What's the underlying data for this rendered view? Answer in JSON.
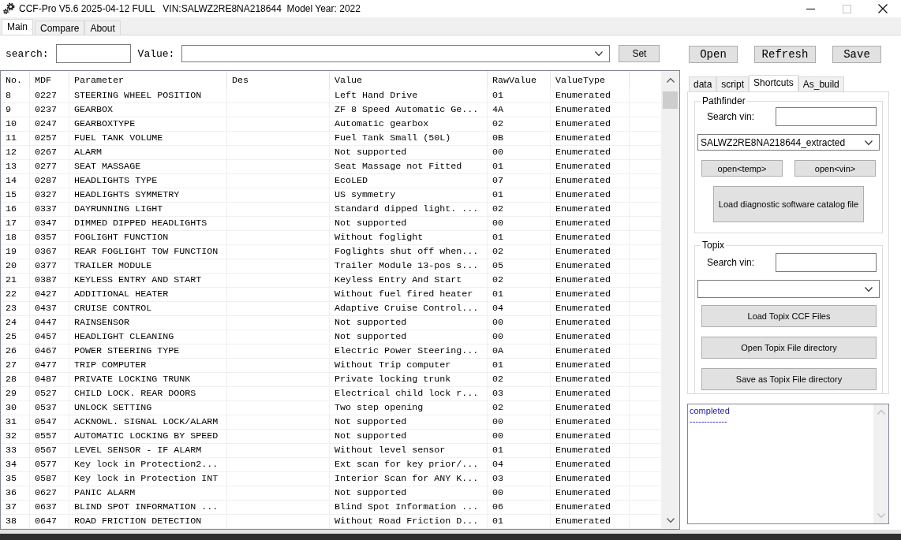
{
  "window": {
    "title": "CCF-Pro V5.6 2025-04-12 FULL   VIN:SALWZ2RE8NA218644  Model Year: 2022"
  },
  "tabs": [
    {
      "label": "Main",
      "selected": true
    },
    {
      "label": "Compare",
      "selected": false
    },
    {
      "label": "About",
      "selected": false
    }
  ],
  "search_bar": {
    "search_label": "search:",
    "value_label": "Value:",
    "set_button": "Set"
  },
  "file_buttons": [
    "Open",
    "Refresh",
    "Save"
  ],
  "table": {
    "columns": [
      "No.",
      "MDF",
      "Parameter",
      "Des",
      "Value",
      "RawValue",
      "ValueType"
    ],
    "rows": [
      {
        "no": "8",
        "mdf": "0227",
        "parameter": "STEERING WHEEL POSITION",
        "value": "Left Hand Drive",
        "raw_value": "01",
        "value_type": "Enumerated"
      },
      {
        "no": "9",
        "mdf": "0237",
        "parameter": "GEARBOX",
        "value": "ZF 8 Speed Automatic Ge...",
        "raw_value": "4A",
        "value_type": "Enumerated"
      },
      {
        "no": "10",
        "mdf": "0247",
        "parameter": "GEARBOXTYPE",
        "value": "Automatic gearbox",
        "raw_value": "02",
        "value_type": "Enumerated"
      },
      {
        "no": "11",
        "mdf": "0257",
        "parameter": "FUEL TANK VOLUME",
        "value": "Fuel Tank Small (50L)",
        "raw_value": "0B",
        "value_type": "Enumerated"
      },
      {
        "no": "12",
        "mdf": "0267",
        "parameter": "ALARM",
        "value": "Not supported",
        "raw_value": "00",
        "value_type": "Enumerated"
      },
      {
        "no": "13",
        "mdf": "0277",
        "parameter": "SEAT MASSAGE",
        "value": "Seat Massage not Fitted",
        "raw_value": "01",
        "value_type": "Enumerated"
      },
      {
        "no": "14",
        "mdf": "0287",
        "parameter": "HEADLIGHTS TYPE",
        "value": "EcoLED",
        "raw_value": "07",
        "value_type": "Enumerated"
      },
      {
        "no": "15",
        "mdf": "0327",
        "parameter": "HEADLIGHTS SYMMETRY",
        "value": "US symmetry",
        "raw_value": "01",
        "value_type": "Enumerated"
      },
      {
        "no": "16",
        "mdf": "0337",
        "parameter": "DAYRUNNING LIGHT",
        "value": "Standard dipped light. ...",
        "raw_value": "02",
        "value_type": "Enumerated"
      },
      {
        "no": "17",
        "mdf": "0347",
        "parameter": "DIMMED DIPPED HEADLIGHTS",
        "value": "Not supported",
        "raw_value": "00",
        "value_type": "Enumerated"
      },
      {
        "no": "18",
        "mdf": "0357",
        "parameter": "FOGLIGHT FUNCTION",
        "value": "Without foglight",
        "raw_value": "01",
        "value_type": "Enumerated"
      },
      {
        "no": "19",
        "mdf": "0367",
        "parameter": "REAR FOGLIGHT TOW FUNCTION",
        "value": "Foglights shut off when...",
        "raw_value": "02",
        "value_type": "Enumerated"
      },
      {
        "no": "20",
        "mdf": "0377",
        "parameter": "TRAILER MODULE",
        "value": "Trailer Module 13-pos s...",
        "raw_value": "05",
        "value_type": "Enumerated"
      },
      {
        "no": "21",
        "mdf": "0387",
        "parameter": "KEYLESS ENTRY AND START",
        "value": "Keyless Entry And Start",
        "raw_value": "02",
        "value_type": "Enumerated"
      },
      {
        "no": "22",
        "mdf": "0427",
        "parameter": "ADDITIONAL HEATER",
        "value": "Without fuel fired heater",
        "raw_value": "01",
        "value_type": "Enumerated"
      },
      {
        "no": "23",
        "mdf": "0437",
        "parameter": "CRUISE CONTROL",
        "value": "Adaptive Cruise Control...",
        "raw_value": "04",
        "value_type": "Enumerated"
      },
      {
        "no": "24",
        "mdf": "0447",
        "parameter": "RAINSENSOR",
        "value": "Not supported",
        "raw_value": "00",
        "value_type": "Enumerated"
      },
      {
        "no": "25",
        "mdf": "0457",
        "parameter": "HEADLIGHT CLEANING",
        "value": "Not supported",
        "raw_value": "00",
        "value_type": "Enumerated"
      },
      {
        "no": "26",
        "mdf": "0467",
        "parameter": "POWER STEERING TYPE",
        "value": "Electric Power Steering...",
        "raw_value": "0A",
        "value_type": "Enumerated"
      },
      {
        "no": "27",
        "mdf": "0477",
        "parameter": "TRIP COMPUTER",
        "value": "Without Trip computer",
        "raw_value": "01",
        "value_type": "Enumerated"
      },
      {
        "no": "28",
        "mdf": "0487",
        "parameter": "PRIVATE LOCKING TRUNK",
        "value": "Private locking trunk",
        "raw_value": "02",
        "value_type": "Enumerated"
      },
      {
        "no": "29",
        "mdf": "0527",
        "parameter": "CHILD LOCK. REAR DOORS",
        "value": "Electrical child lock r...",
        "raw_value": "03",
        "value_type": "Enumerated"
      },
      {
        "no": "30",
        "mdf": "0537",
        "parameter": "UNLOCK SETTING",
        "value": "Two step opening",
        "raw_value": "02",
        "value_type": "Enumerated"
      },
      {
        "no": "31",
        "mdf": "0547",
        "parameter": "ACKNOWL. SIGNAL LOCK/ALARM",
        "value": "Not supported",
        "raw_value": "00",
        "value_type": "Enumerated"
      },
      {
        "no": "32",
        "mdf": "0557",
        "parameter": "AUTOMATIC LOCKING BY SPEED",
        "value": "Not supported",
        "raw_value": "00",
        "value_type": "Enumerated"
      },
      {
        "no": "33",
        "mdf": "0567",
        "parameter": "LEVEL SENSOR - IF ALARM",
        "value": "Without level sensor",
        "raw_value": "01",
        "value_type": "Enumerated"
      },
      {
        "no": "34",
        "mdf": "0577",
        "parameter": "Key lock in Protection2...",
        "value": "Ext scan for key prior/...",
        "raw_value": "04",
        "value_type": "Enumerated"
      },
      {
        "no": "35",
        "mdf": "0587",
        "parameter": "Key lock in Protection INT",
        "value": "Interior Scan for ANY K...",
        "raw_value": "03",
        "value_type": "Enumerated"
      },
      {
        "no": "36",
        "mdf": "0627",
        "parameter": "PANIC ALARM",
        "value": "Not supported",
        "raw_value": "00",
        "value_type": "Enumerated"
      },
      {
        "no": "37",
        "mdf": "0637",
        "parameter": "BLIND SPOT INFORMATION ...",
        "value": "Blind Spot Information ...",
        "raw_value": "06",
        "value_type": "Enumerated"
      },
      {
        "no": "38",
        "mdf": "0647",
        "parameter": "ROAD FRICTION DETECTION",
        "value": "Without Road Friction D...",
        "raw_value": "01",
        "value_type": "Enumerated"
      }
    ]
  },
  "side_panel": {
    "tabs": [
      {
        "label": "data",
        "selected": false
      },
      {
        "label": "script",
        "selected": false
      },
      {
        "label": "Shortcuts",
        "selected": true
      },
      {
        "label": "As_build",
        "selected": false
      }
    ],
    "pathfinder": {
      "title": "Pathfinder",
      "search_label": "Search vin:",
      "selected_file": "SALWZ2RE8NA218644_extracted",
      "open_buttons": [
        "open<temp>",
        "open<vin>"
      ],
      "load_button": "Load diagnostic software catalog file"
    },
    "topix": {
      "title": "Topix",
      "search_label": "Search vin:",
      "buttons": [
        "Load Topix CCF Files",
        "Open Topix File directory",
        "Save as Topix File directory"
      ]
    }
  },
  "log": {
    "lines": [
      "completed",
      "-------------"
    ]
  }
}
